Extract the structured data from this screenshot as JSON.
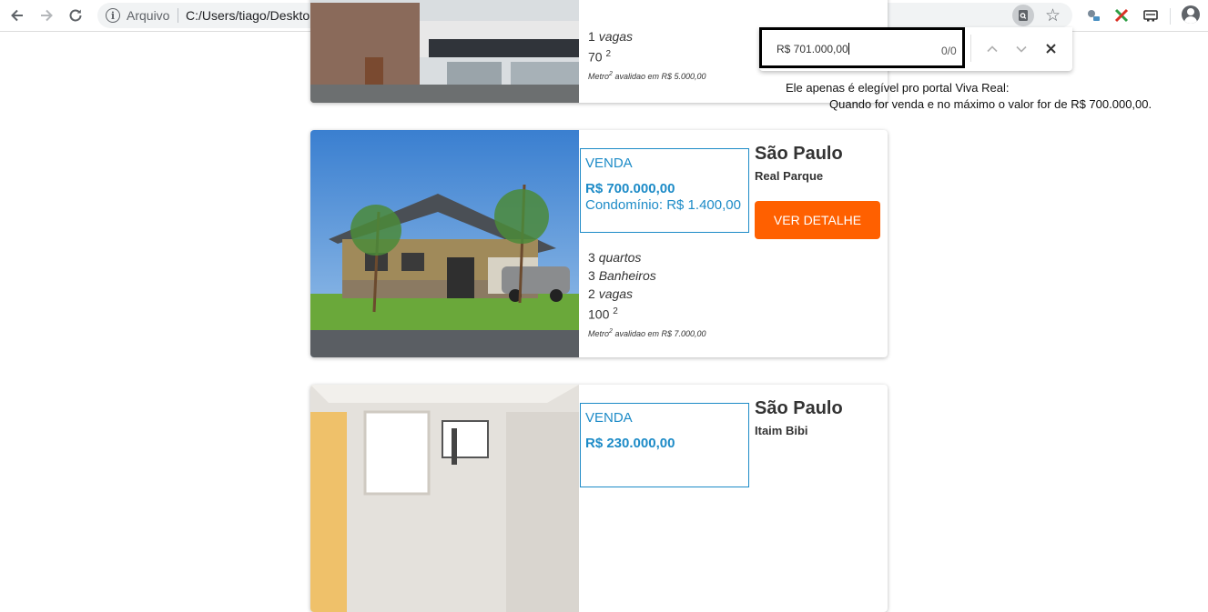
{
  "browser": {
    "scheme_label": "Arquivo",
    "url": "C:/Users/tiago/Desktop/zap/index.html",
    "icons": [
      "back-arrow-icon",
      "forward-arrow-icon",
      "reload-icon",
      "info-icon",
      "find-in-page-icon",
      "star-icon",
      "extension-icon",
      "puzzle-x-icon",
      "cast-icon",
      "profile-icon"
    ]
  },
  "find_bar": {
    "query": "R$ 701.000,00",
    "count": "0/0",
    "prev_icon": "chevron-up-icon",
    "next_icon": "chevron-down-icon",
    "close_icon": "close-icon"
  },
  "annotation": {
    "line1": "Ele apenas é elegível pro portal Viva Real:",
    "line2": "Quando for venda e no máximo o valor for de R$ 700.000,00."
  },
  "listings": [
    {
      "parking": "1",
      "parking_label": "vagas",
      "area": "70",
      "metro_text": "avalidao em R$ 5.000,00"
    },
    {
      "type": "VENDA",
      "price": "R$ 700.000,00",
      "condo": "Condomínio: R$ 1.400,00",
      "city": "São Paulo",
      "district": "Real Parque",
      "button": "VER DETALHE",
      "bedrooms": "3",
      "bedrooms_label": "quartos",
      "bathrooms": "3",
      "bathrooms_label": "Banheiros",
      "parking": "2",
      "parking_label": "vagas",
      "area": "100",
      "metro_text": "avalidao em R$ 7.000,00"
    },
    {
      "type": "VENDA",
      "price": "R$ 230.000,00",
      "city": "São Paulo",
      "district": "Itaim Bibi"
    }
  ],
  "common": {
    "sup_two": "2",
    "metro_word": "Metro"
  },
  "colors": {
    "accent_blue": "#1d8bc7",
    "button_orange": "#ff6000"
  }
}
